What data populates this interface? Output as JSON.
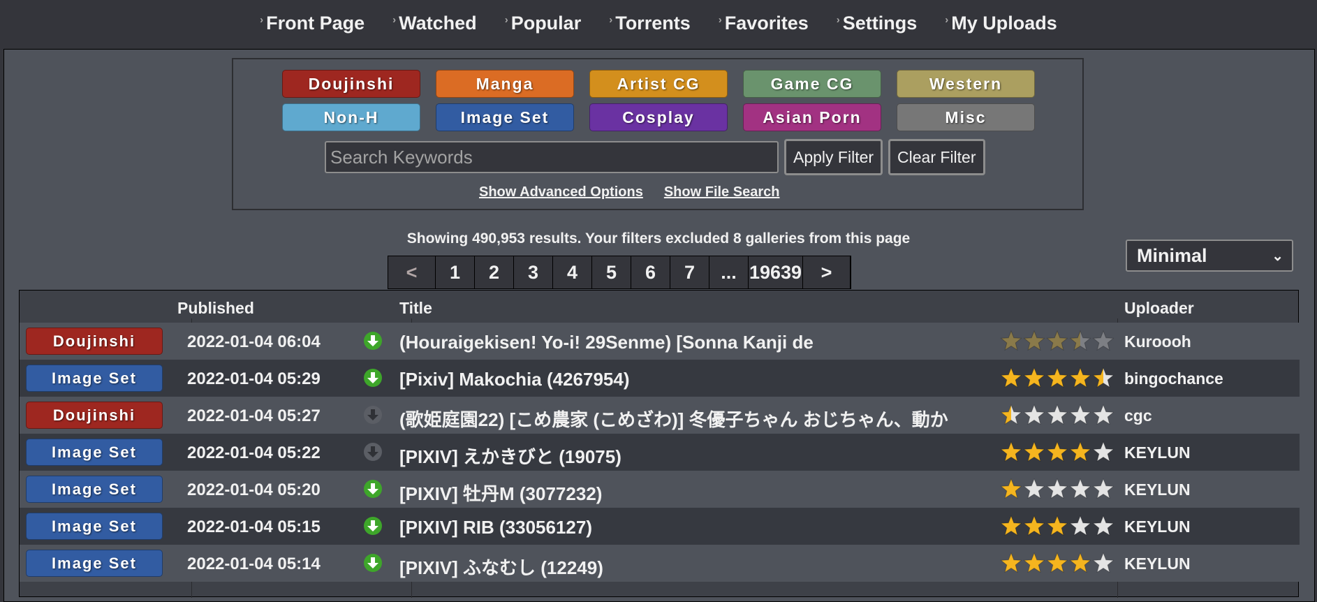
{
  "nav": [
    {
      "label": "Front Page"
    },
    {
      "label": "Watched"
    },
    {
      "label": "Popular"
    },
    {
      "label": "Torrents"
    },
    {
      "label": "Favorites"
    },
    {
      "label": "Settings"
    },
    {
      "label": "My Uploads"
    }
  ],
  "categories": [
    {
      "label": "Doujinshi",
      "color": "#9e2720"
    },
    {
      "label": "Manga",
      "color": "#db6c24"
    },
    {
      "label": "Artist CG",
      "color": "#d38f1d"
    },
    {
      "label": "Game CG",
      "color": "#6a936d"
    },
    {
      "label": "Western",
      "color": "#ab9f60"
    },
    {
      "label": "Non-H",
      "color": "#5fa9cf"
    },
    {
      "label": "Image Set",
      "color": "#325ca2"
    },
    {
      "label": "Cosplay",
      "color": "#6a32a2"
    },
    {
      "label": "Asian Porn",
      "color": "#a23282"
    },
    {
      "label": "Misc",
      "color": "#777777"
    }
  ],
  "search": {
    "placeholder": "Search Keywords",
    "apply_label": "Apply Filter",
    "clear_label": "Clear Filter",
    "advanced_label": "Show Advanced Options",
    "file_search_label": "Show File Search"
  },
  "results_text": "Showing 490,953 results. Your filters excluded 8 galleries from this page",
  "pager": [
    "<",
    "1",
    "2",
    "3",
    "4",
    "5",
    "6",
    "7",
    "...",
    "19639",
    ">"
  ],
  "display_mode": "Minimal",
  "table": {
    "headers": {
      "published": "Published",
      "title": "Title",
      "uploader": "Uploader"
    },
    "rows": [
      {
        "category": "Doujinshi",
        "color": "#9e2720",
        "date": "2022-01-04 06:04",
        "download": true,
        "title": "(Houraigekisen! Yo-i! 29Senme) [Sonna Kanji de",
        "rating": 3.5,
        "rating_dim": true,
        "uploader": "Kuroooh"
      },
      {
        "category": "Image Set",
        "color": "#325ca2",
        "date": "2022-01-04 05:29",
        "download": true,
        "title": "[Pixiv] Makochia (4267954)",
        "rating": 4.5,
        "rating_dim": false,
        "uploader": "bingochance"
      },
      {
        "category": "Doujinshi",
        "color": "#9e2720",
        "date": "2022-01-04 05:27",
        "download": false,
        "title": "(歌姫庭園22) [こめ農家 (こめざわ)] 冬優子ちゃん おじちゃん、動か",
        "rating": 0.5,
        "rating_dim": false,
        "uploader": "cgc"
      },
      {
        "category": "Image Set",
        "color": "#325ca2",
        "date": "2022-01-04 05:22",
        "download": false,
        "title": "[PIXIV] えかきびと (19075)",
        "rating": 4,
        "rating_dim": false,
        "uploader": "KEYLUN"
      },
      {
        "category": "Image Set",
        "color": "#325ca2",
        "date": "2022-01-04 05:20",
        "download": true,
        "title": "[PIXIV] 牡丹M (3077232)",
        "rating": 1,
        "rating_dim": false,
        "uploader": "KEYLUN"
      },
      {
        "category": "Image Set",
        "color": "#325ca2",
        "date": "2022-01-04 05:15",
        "download": true,
        "title": "[PIXIV] RIB (33056127)",
        "rating": 3,
        "rating_dim": false,
        "uploader": "KEYLUN"
      },
      {
        "category": "Image Set",
        "color": "#325ca2",
        "date": "2022-01-04 05:14",
        "download": true,
        "title": "[PIXIV] ふなむし (12249)",
        "rating": 4,
        "rating_dim": false,
        "uploader": "KEYLUN"
      }
    ]
  }
}
